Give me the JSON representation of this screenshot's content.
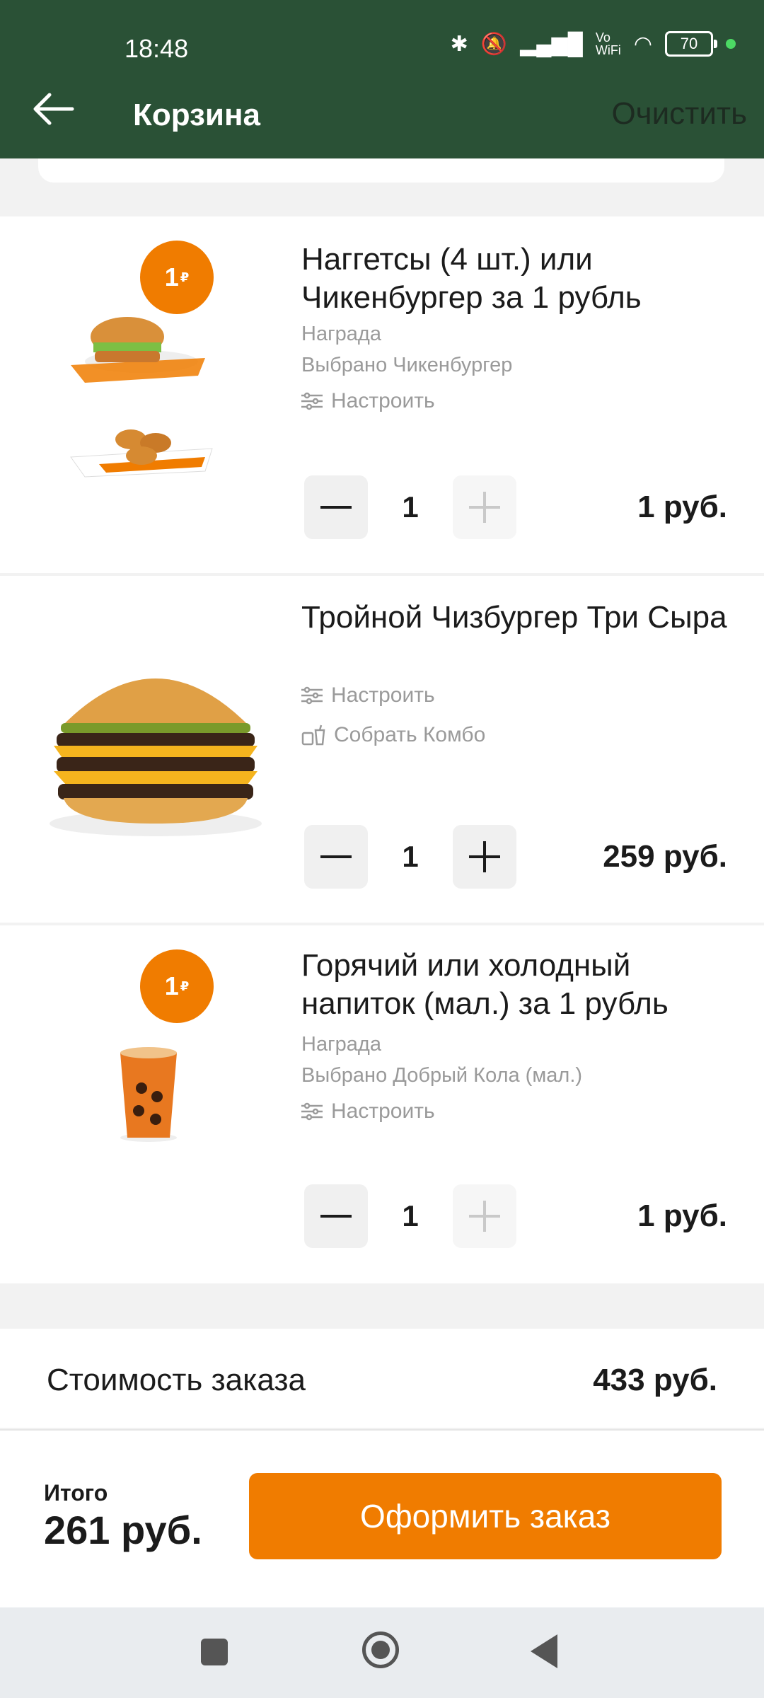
{
  "status_bar": {
    "time": "18:48",
    "battery": "70"
  },
  "header": {
    "title": "Корзина",
    "clear_label": "Очистить"
  },
  "items": [
    {
      "name": "Наггетсы (4 шт.) или Чикенбургер за 1 рубль",
      "badge": "1",
      "badge_currency": "₽",
      "reward_label": "Награда",
      "selected": "Выбрано Чикенбургер",
      "configure": "Настроить",
      "quantity": "1",
      "price": "1 руб."
    },
    {
      "name": "Тройной Чизбургер Три Сыра",
      "configure": "Настроить",
      "combo": "Собрать Комбо",
      "quantity": "1",
      "price": "259 руб."
    },
    {
      "name": "Горячий или холодный напиток (мал.) за 1 рубль",
      "badge": "1",
      "badge_currency": "₽",
      "reward_label": "Награда",
      "selected": "Выбрано Добрый Кола (мал.)",
      "configure": "Настроить",
      "quantity": "1",
      "price": "1 руб."
    }
  ],
  "summary": {
    "order_cost_label": "Стоимость заказа",
    "order_cost_value": "433 руб."
  },
  "footer": {
    "total_label": "Итого",
    "total_value": "261 руб.",
    "checkout_label": "Оформить заказ"
  },
  "colors": {
    "header_bg": "#2a5136",
    "accent": "#f07c00",
    "discount": "#4e3aa6"
  }
}
